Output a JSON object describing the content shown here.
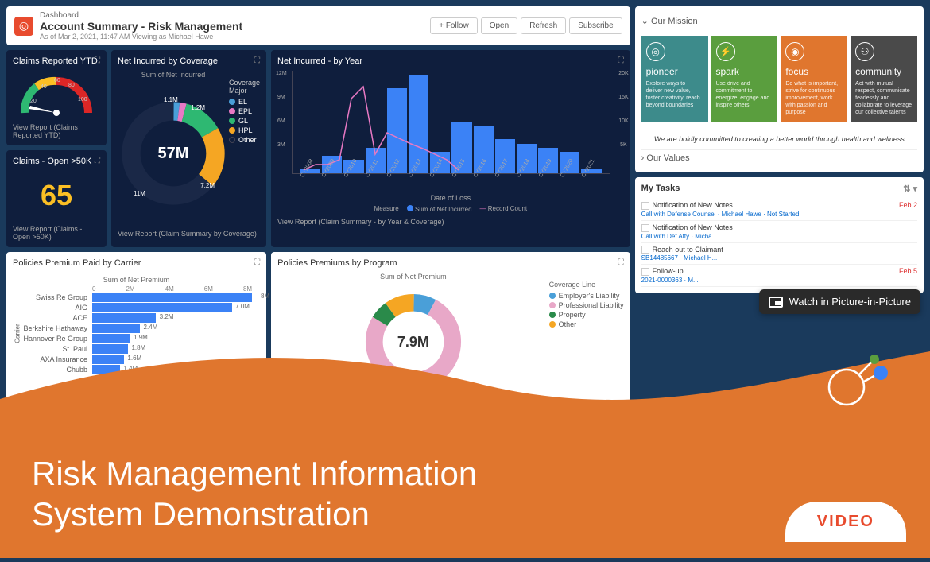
{
  "header": {
    "breadcrumb": "Dashboard",
    "title": "Account Summary - Risk Management",
    "subtitle": "As of Mar 2, 2021, 11:47 AM Viewing as Michael Hawe",
    "actions": {
      "follow": "+ Follow",
      "open": "Open",
      "refresh": "Refresh",
      "subscribe": "Subscribe"
    }
  },
  "widgets": {
    "claims_ytd": {
      "title": "Claims Reported YTD",
      "link": "View Report (Claims Reported YTD)"
    },
    "claims_open": {
      "title": "Claims - Open >50K",
      "value": "65",
      "link": "View Report (Claims - Open >50K)"
    },
    "net_coverage": {
      "title": "Net Incurred by Coverage",
      "subtitle": "Sum of Net Incurred",
      "center": "57M",
      "legend_title": "Coverage Major",
      "link": "View Report (Claim Summary by Coverage)"
    },
    "net_year": {
      "title": "Net Incurred - by Year",
      "xlabel": "Date of Loss",
      "measure": "Measure",
      "m1": "Sum of Net Incurred",
      "m2": "Record Count",
      "link": "View Report (Claim Summary - by Year & Coverage)"
    },
    "premium_carrier": {
      "title": "Policies Premium Paid by Carrier",
      "subtitle": "Sum of Net Premium",
      "ylabel": "Carrier"
    },
    "premium_program": {
      "title": "Policies Premiums by Program",
      "subtitle": "Sum of Net Premium",
      "center": "7.9M",
      "legend_title": "Coverage Line"
    }
  },
  "mission": {
    "header": "Our Mission",
    "values_header": "Our Values",
    "statement": "We are boldly committed to creating a better world through health and wellness",
    "tiles": [
      {
        "title": "pioneer",
        "text": "Explore ways to deliver new value, foster creativity, reach beyond boundaries",
        "color": "#3d8b8b"
      },
      {
        "title": "spark",
        "text": "Use drive and commitment to energize, engage and inspire others",
        "color": "#5a9e3e"
      },
      {
        "title": "focus",
        "text": "Do what is important, strive for continuous improvement, work with passion and purpose",
        "color": "#e0762e"
      },
      {
        "title": "community",
        "text": "Act with mutual respect, communicate fearlessly and collaborate to leverage our collective talents",
        "color": "#4a4a4a"
      }
    ]
  },
  "tasks": {
    "title": "My Tasks",
    "items": [
      {
        "title": "Notification of New Notes",
        "date": "Feb 2",
        "detail": "Call with Defense Counsel · Michael Hawe · Not Started"
      },
      {
        "title": "Notification of New Notes",
        "date": "",
        "detail": "Call with Def Atty · Micha..."
      },
      {
        "title": "Reach out to Claimant",
        "date": "",
        "detail": "SB14485667 · Michael H..."
      },
      {
        "title": "Follow-up",
        "date": "Feb 5",
        "detail": "2021-0000363 · M..."
      }
    ]
  },
  "pip": "Watch in Picture-in-Picture",
  "overlay": {
    "title_l1": "Risk Management Information",
    "title_l2": "System Demonstration",
    "badge": "VIDEO"
  },
  "chart_data": [
    {
      "type": "gauge",
      "title": "Claims Reported YTD",
      "min": 0,
      "max": 100,
      "ticks": [
        20,
        40,
        60,
        80,
        100
      ],
      "value": 15
    },
    {
      "type": "pie",
      "title": "Net Incurred by Coverage",
      "center_total": "57M",
      "series": [
        {
          "name": "EL",
          "value": 1.1,
          "color": "#4a9fd8"
        },
        {
          "name": "EPL",
          "value": 1.2,
          "color": "#e879c4"
        },
        {
          "name": "GL",
          "value": 7.2,
          "color": "#2eb872"
        },
        {
          "name": "HPL",
          "value": 11,
          "color": "#f5a623"
        },
        {
          "name": "Other",
          "value": 36.5,
          "color": "#0f1e3d"
        }
      ],
      "labels": [
        "1.1M",
        "1.2M",
        "7.2M",
        "11M"
      ]
    },
    {
      "type": "bar",
      "title": "Net Incurred - by Year",
      "xlabel": "Date of Loss",
      "ylabel": "Sum of Net Incurred",
      "categories": [
        "CY2008",
        "CY2009",
        "CY2010",
        "CY2011",
        "CY2012",
        "CY2013",
        "CY2014",
        "CY2015",
        "CY2016",
        "CY2017",
        "CY2018",
        "CY2019",
        "CY2020",
        "CY2021"
      ],
      "values": [
        0.5,
        2,
        1.5,
        3,
        10,
        11.5,
        2.5,
        6,
        5.5,
        4,
        3.5,
        3,
        2.5,
        0.5
      ],
      "y_ticks": [
        "3M",
        "6M",
        "9M",
        "12M"
      ],
      "y2_ticks": [
        "5K",
        "10K",
        "15K",
        "20K"
      ],
      "line_series": {
        "name": "Record Count",
        "values": [
          1,
          2,
          2,
          3,
          15,
          17,
          4,
          8,
          7,
          6,
          5,
          4,
          3,
          1
        ]
      }
    },
    {
      "type": "bar",
      "orientation": "horizontal",
      "title": "Policies Premium Paid by Carrier",
      "xlabel": "Sum of Net Premium",
      "ylabel": "Carrier",
      "categories": [
        "Swiss Re Group",
        "AIG",
        "ACE",
        "Berkshire Hathaway",
        "Hannover Re Group",
        "St. Paul",
        "AXA Insurance",
        "Chubb"
      ],
      "values": [
        8.0,
        7.0,
        3.2,
        2.4,
        1.9,
        1.8,
        1.6,
        1.4
      ],
      "value_labels": [
        "8M",
        "7.0M",
        "3.2M",
        "2.4M",
        "1.9M",
        "1.8M",
        "1.6M",
        "1.4M"
      ],
      "x_ticks": [
        "0",
        "2M",
        "4M",
        "6M",
        "8M"
      ]
    },
    {
      "type": "pie",
      "title": "Policies Premiums by Program",
      "center_total": "7.9M",
      "series": [
        {
          "name": "Employer's Liability",
          "value": 0.6,
          "color": "#4a9fd8"
        },
        {
          "name": "Professional Liability",
          "value": 6.0,
          "color": "#e8a8c8"
        },
        {
          "name": "Property",
          "value": 0.5,
          "color": "#2a8a4a"
        },
        {
          "name": "Other",
          "value": 0.8,
          "color": "#f5a623"
        }
      ]
    }
  ]
}
